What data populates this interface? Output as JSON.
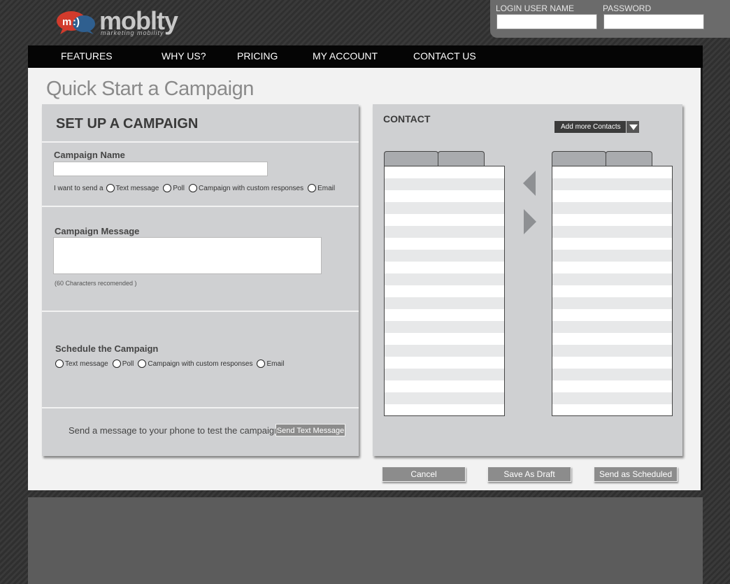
{
  "brand": {
    "name": "moblty",
    "tagline": "marketing mobility",
    "accent": "#d23b2c"
  },
  "login": {
    "username_label": "LOGIN USER NAME",
    "password_label": "PASSWORD",
    "username_value": "",
    "password_value": ""
  },
  "nav": {
    "items": [
      {
        "label": "FEATURES"
      },
      {
        "label": "WHY US?"
      },
      {
        "label": "PRICING"
      },
      {
        "label": "MY ACCOUNT"
      },
      {
        "label": "CONTACT US"
      }
    ]
  },
  "page": {
    "title": "Quick Start a Campaign"
  },
  "setup": {
    "title": "SET UP A CAMPAIGN",
    "campaign_name_label": "Campaign Name",
    "campaign_name_value": "",
    "send_prefix": "I want to send a",
    "send_options": [
      {
        "label": "Text message"
      },
      {
        "label": "Poll"
      },
      {
        "label": "Campaign with custom responses"
      },
      {
        "label": "Email"
      }
    ],
    "message_label": "Campaign Message",
    "message_value": "",
    "message_hint": "(60 Characters recomended )",
    "schedule_label": "Schedule the Campaign",
    "schedule_options": [
      {
        "label": "Text message"
      },
      {
        "label": "Poll"
      },
      {
        "label": "Campaign with custom responses"
      },
      {
        "label": "Email"
      }
    ],
    "test_text": "Send a message to your phone to test the campaign",
    "test_button": "Send Text Message"
  },
  "contact": {
    "title": "CONTACT",
    "add_button": "Add more Contacts"
  },
  "actions": {
    "cancel": "Cancel",
    "save_draft": "Save As Draft",
    "send_scheduled": "Send as Scheduled"
  }
}
